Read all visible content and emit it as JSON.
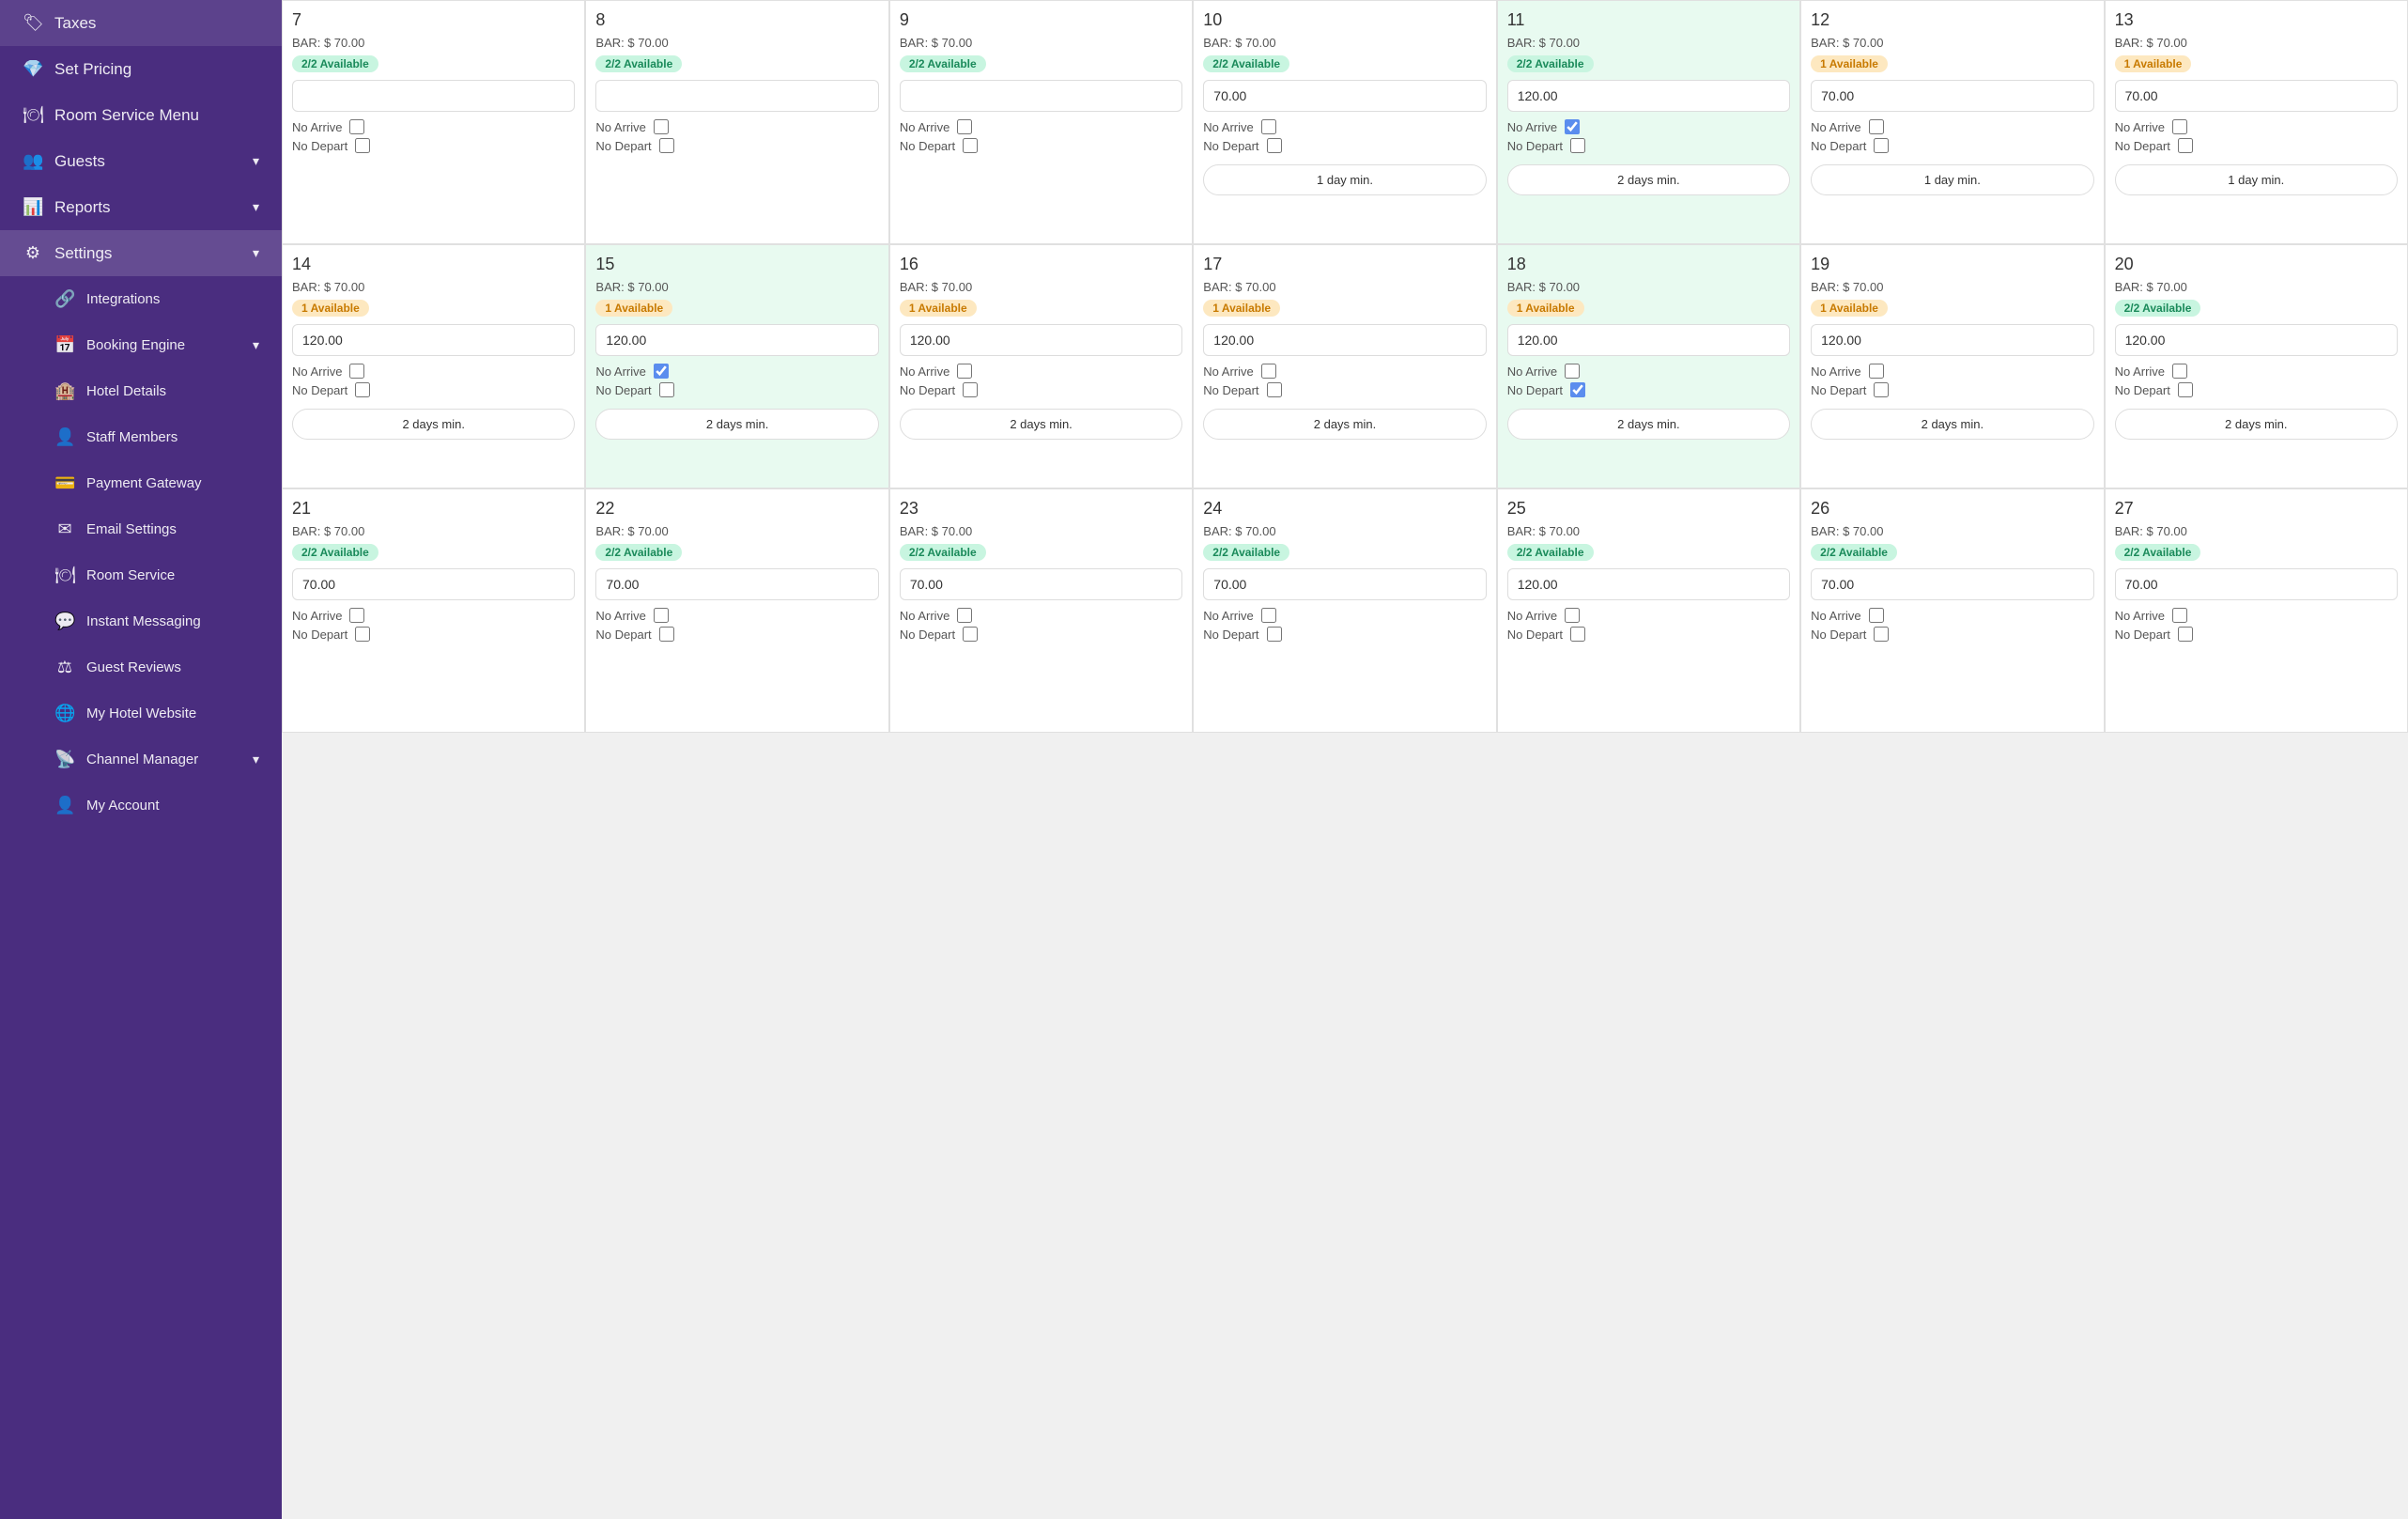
{
  "sidebar": {
    "items": [
      {
        "id": "taxes",
        "label": "Taxes",
        "icon": "🏷",
        "chevron": false
      },
      {
        "id": "set-pricing",
        "label": "Set Pricing",
        "icon": "💎",
        "chevron": false
      },
      {
        "id": "room-service-menu",
        "label": "Room Service Menu",
        "icon": "🍽",
        "chevron": false
      },
      {
        "id": "guests",
        "label": "Guests",
        "icon": "👥",
        "chevron": true
      },
      {
        "id": "reports",
        "label": "Reports",
        "icon": "📊",
        "chevron": true
      },
      {
        "id": "settings",
        "label": "Settings",
        "icon": "⚙",
        "chevron": true,
        "active": true
      },
      {
        "id": "integrations",
        "label": "Integrations",
        "icon": "🔗",
        "sub": true
      },
      {
        "id": "booking-engine",
        "label": "Booking Engine",
        "icon": "📅",
        "chevron": true,
        "sub": true
      },
      {
        "id": "hotel-details",
        "label": "Hotel Details",
        "icon": "🏨",
        "sub": true
      },
      {
        "id": "staff-members",
        "label": "Staff Members",
        "icon": "👤",
        "sub": true
      },
      {
        "id": "payment-gateway",
        "label": "Payment Gateway",
        "icon": "💳",
        "sub": true
      },
      {
        "id": "email-settings",
        "label": "Email Settings",
        "icon": "✉",
        "sub": true
      },
      {
        "id": "room-service",
        "label": "Room Service",
        "icon": "🍽",
        "sub": true
      },
      {
        "id": "instant-messaging",
        "label": "Instant Messaging",
        "icon": "💬",
        "sub": true
      },
      {
        "id": "guest-reviews",
        "label": "Guest Reviews",
        "icon": "⚖",
        "sub": true
      },
      {
        "id": "my-hotel-website",
        "label": "My Hotel Website",
        "icon": "🌐",
        "sub": true
      },
      {
        "id": "channel-manager",
        "label": "Channel Manager",
        "icon": "📡",
        "chevron": true,
        "sub": true
      },
      {
        "id": "my-account",
        "label": "My Account",
        "icon": "👤",
        "sub": true
      }
    ]
  },
  "calendar": {
    "rows": [
      {
        "days": [
          {
            "num": 7,
            "bar": "$ 70.00",
            "avail": "2/2 Available",
            "availType": "green",
            "price": "",
            "noArrive": false,
            "noDepart": false,
            "minDays": null
          },
          {
            "num": 8,
            "bar": "$ 70.00",
            "avail": "2/2 Available",
            "availType": "green",
            "price": "",
            "noArrive": false,
            "noDepart": false,
            "minDays": null
          },
          {
            "num": 9,
            "bar": "$ 70.00",
            "avail": "2/2 Available",
            "availType": "green",
            "price": "",
            "noArrive": false,
            "noDepart": false,
            "minDays": null
          },
          {
            "num": 10,
            "bar": "$ 70.00",
            "avail": "2/2 Available",
            "availType": "green",
            "price": "70.00",
            "noArrive": false,
            "noDepart": false,
            "minDays": "1 day min."
          },
          {
            "num": 11,
            "bar": "$ 70.00",
            "avail": "2/2 Available",
            "availType": "green",
            "price": "120.00",
            "noArrive": true,
            "noDepart": false,
            "minDays": "2 days min.",
            "bgGreen": true
          },
          {
            "num": 12,
            "bar": "$ 70.00",
            "avail": "1 Available",
            "availType": "orange",
            "price": "70.00",
            "noArrive": false,
            "noDepart": false,
            "minDays": "1 day min."
          },
          {
            "num": 13,
            "bar": "$ 70.00",
            "avail": "1 Available",
            "availType": "orange",
            "price": "70.00",
            "noArrive": false,
            "noDepart": false,
            "minDays": "1 day min."
          }
        ]
      },
      {
        "days": [
          {
            "num": 14,
            "bar": "$ 70.00",
            "avail": "1 Available",
            "availType": "orange",
            "price": "120.00",
            "noArrive": false,
            "noDepart": false,
            "minDays": "2 days min."
          },
          {
            "num": 15,
            "bar": "$ 70.00",
            "avail": "1 Available",
            "availType": "orange",
            "price": "120.00",
            "noArrive": true,
            "noDepart": false,
            "minDays": "2 days min.",
            "bgGreen": true
          },
          {
            "num": 16,
            "bar": "$ 70.00",
            "avail": "1 Available",
            "availType": "orange",
            "price": "120.00",
            "noArrive": false,
            "noDepart": false,
            "minDays": "2 days min."
          },
          {
            "num": 17,
            "bar": "$ 70.00",
            "avail": "1 Available",
            "availType": "orange",
            "price": "120.00",
            "noArrive": false,
            "noDepart": false,
            "minDays": "2 days min."
          },
          {
            "num": 18,
            "bar": "$ 70.00",
            "avail": "1 Available",
            "availType": "orange",
            "price": "120.00",
            "noArrive": false,
            "noDepart": true,
            "minDays": "2 days min.",
            "bgGreen": true
          },
          {
            "num": 19,
            "bar": "$ 70.00",
            "avail": "1 Available",
            "availType": "orange",
            "price": "120.00",
            "noArrive": false,
            "noDepart": false,
            "minDays": "2 days min."
          },
          {
            "num": 20,
            "bar": "$ 70.00",
            "avail": "2/2 Available",
            "availType": "green",
            "price": "120.00",
            "noArrive": false,
            "noDepart": false,
            "minDays": "2 days min."
          }
        ]
      },
      {
        "days": [
          {
            "num": 21,
            "bar": "$ 70.00",
            "avail": "2/2 Available",
            "availType": "green",
            "price": "70.00",
            "noArrive": false,
            "noDepart": false,
            "minDays": null
          },
          {
            "num": 22,
            "bar": "$ 70.00",
            "avail": "2/2 Available",
            "availType": "green",
            "price": "70.00",
            "noArrive": false,
            "noDepart": false,
            "minDays": null
          },
          {
            "num": 23,
            "bar": "$ 70.00",
            "avail": "2/2 Available",
            "availType": "green",
            "price": "70.00",
            "noArrive": false,
            "noDepart": false,
            "minDays": null
          },
          {
            "num": 24,
            "bar": "$ 70.00",
            "avail": "2/2 Available",
            "availType": "green",
            "price": "70.00",
            "noArrive": false,
            "noDepart": false,
            "minDays": null
          },
          {
            "num": 25,
            "bar": "$ 70.00",
            "avail": "2/2 Available",
            "availType": "green",
            "price": "120.00",
            "noArrive": false,
            "noDepart": false,
            "minDays": null
          },
          {
            "num": 26,
            "bar": "$ 70.00",
            "avail": "2/2 Available",
            "availType": "green",
            "price": "70.00",
            "noArrive": false,
            "noDepart": false,
            "minDays": null
          },
          {
            "num": 27,
            "bar": "$ 70.00",
            "avail": "2/2 Available",
            "availType": "green",
            "price": "70.00",
            "noArrive": false,
            "noDepart": false,
            "minDays": null
          }
        ]
      }
    ],
    "labels": {
      "noArrive": "No Arrive",
      "noDepart": "No Depart",
      "bar": "BAR:"
    }
  }
}
